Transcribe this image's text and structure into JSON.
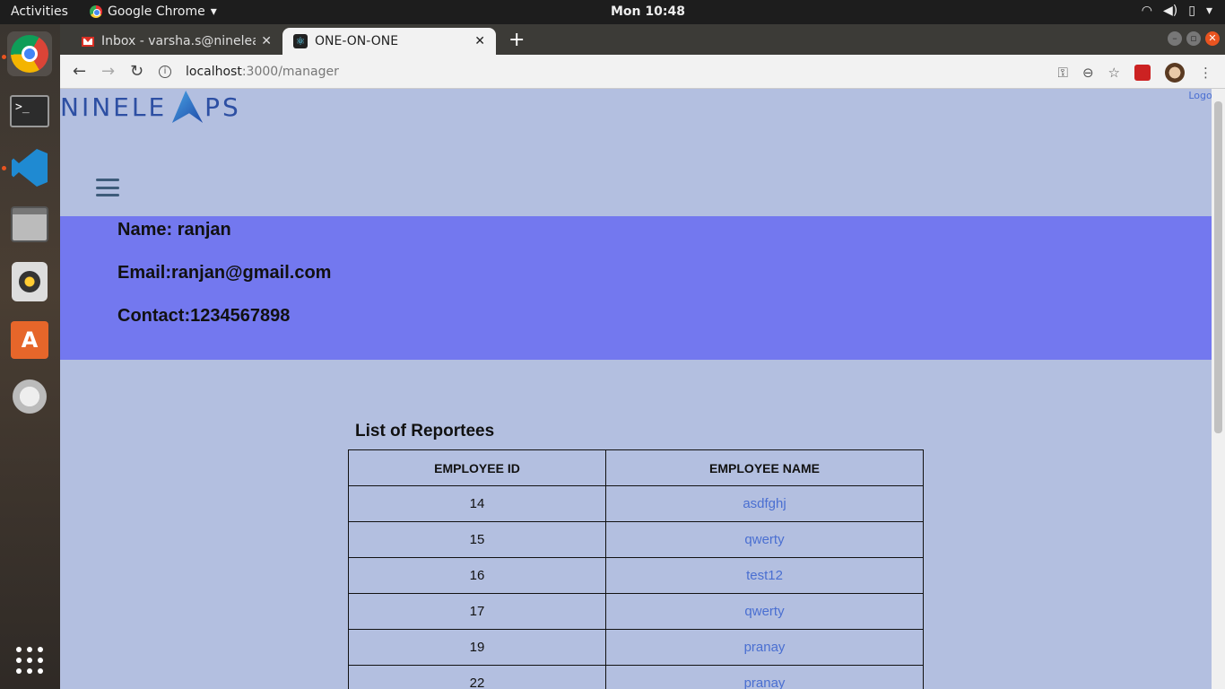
{
  "system": {
    "activities": "Activities",
    "app_name": "Google Chrome",
    "clock": "Mon 10:48"
  },
  "browser": {
    "tabs": [
      {
        "title": "Inbox - varsha.s@ninelea",
        "icon": "gmail-icon"
      },
      {
        "title": "ONE-ON-ONE",
        "icon": "react-icon"
      }
    ],
    "url_host": "localhost",
    "url_path": ":3000/manager"
  },
  "page": {
    "logout": "Logout",
    "logo": {
      "left": "NINELE",
      "right": "PS"
    },
    "profile": {
      "name": "Name: ranjan",
      "email": "Email:ranjan@gmail.com",
      "contact": "Contact:1234567898"
    },
    "reportees": {
      "title": "List of Reportees",
      "headers": [
        "EMPLOYEE ID",
        "EMPLOYEE NAME"
      ],
      "rows": [
        {
          "id": "14",
          "name": "asdfghj"
        },
        {
          "id": "15",
          "name": "qwerty"
        },
        {
          "id": "16",
          "name": "test12"
        },
        {
          "id": "17",
          "name": "qwerty"
        },
        {
          "id": "19",
          "name": "pranay"
        },
        {
          "id": "22",
          "name": "pranay"
        }
      ]
    }
  },
  "colors": {
    "page_bg": "#b3bfe0",
    "profile_bg": "#7378ef",
    "link": "#4a6fd1"
  }
}
